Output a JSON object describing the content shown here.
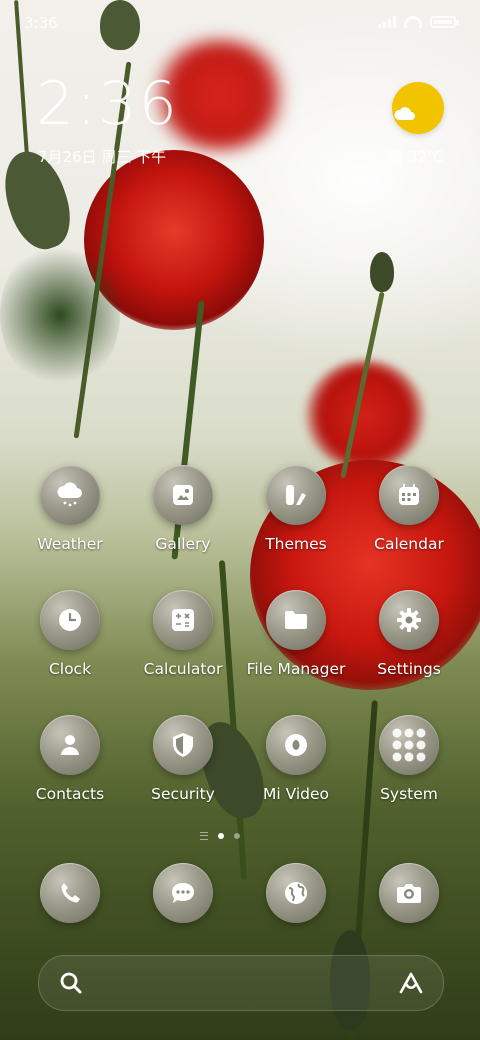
{
  "status_bar": {
    "time": "3:36"
  },
  "clock_widget": {
    "time": "2:36",
    "date": "7月26日 周三 下午"
  },
  "weather_widget": {
    "temp": "晴 32℃",
    "icon": "sun-cloud-icon",
    "color": "#f2c400"
  },
  "apps": [
    {
      "label": "Weather",
      "icon": "weather-icon"
    },
    {
      "label": "Gallery",
      "icon": "gallery-icon"
    },
    {
      "label": "Themes",
      "icon": "themes-icon"
    },
    {
      "label": "Calendar",
      "icon": "calendar-icon"
    },
    {
      "label": "Clock",
      "icon": "clock-icon"
    },
    {
      "label": "Calculator",
      "icon": "calculator-icon"
    },
    {
      "label": "File Manager",
      "icon": "folder-icon"
    },
    {
      "label": "Settings",
      "icon": "gear-icon"
    },
    {
      "label": "Contacts",
      "icon": "contacts-icon"
    },
    {
      "label": "Security",
      "icon": "shield-icon"
    },
    {
      "label": "Mi Video",
      "icon": "video-icon"
    },
    {
      "label": "System",
      "icon": "app-folder-icon"
    }
  ],
  "page_indicator": {
    "pages": 2,
    "current": 1
  },
  "dock": [
    {
      "icon": "phone-icon"
    },
    {
      "icon": "messages-icon"
    },
    {
      "icon": "browser-icon"
    },
    {
      "icon": "camera-icon"
    }
  ],
  "search_bar": {
    "left_icon": "search-icon",
    "right_icon": "assistant-icon"
  }
}
